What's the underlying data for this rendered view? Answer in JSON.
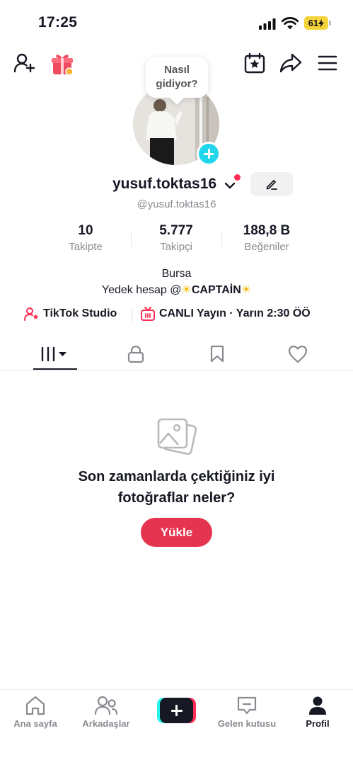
{
  "status_bar": {
    "time": "17:25",
    "battery": "61"
  },
  "bubble": {
    "line1": "Nasıl",
    "line2": "gidiyor?"
  },
  "profile": {
    "username": "yusuf.toktas16",
    "handle": "@yusuf.toktas16",
    "stats": [
      {
        "value": "10",
        "label": "Takipte"
      },
      {
        "value": "5.777",
        "label": "Takipçi"
      },
      {
        "value": "188,8 B",
        "label": "Beğeniler"
      }
    ],
    "bio_line1": "Bursa",
    "bio_line2_prefix": "Yedek hesap @",
    "bio_line2_name": "CAPTAİN",
    "links": {
      "studio": "TikTok Studio",
      "live": "CANLI Yayın · Yarın 2:30 ÖÖ"
    }
  },
  "empty_state": {
    "title": "Son zamanlarda çektiğiniz iyi fotoğraflar neler?",
    "button": "Yükle"
  },
  "bottom_nav": [
    {
      "label": "Ana sayfa",
      "icon": "home-icon"
    },
    {
      "label": "Arkadaşlar",
      "icon": "friends-icon"
    },
    {
      "label": "",
      "icon": "create-icon"
    },
    {
      "label": "Gelen kutusu",
      "icon": "inbox-icon"
    },
    {
      "label": "Profil",
      "icon": "profile-icon"
    }
  ],
  "colors": {
    "accent": "#fe2c55",
    "upload": "#e4344f",
    "cyan": "#20d5ec",
    "battery": "#f5d33a"
  }
}
